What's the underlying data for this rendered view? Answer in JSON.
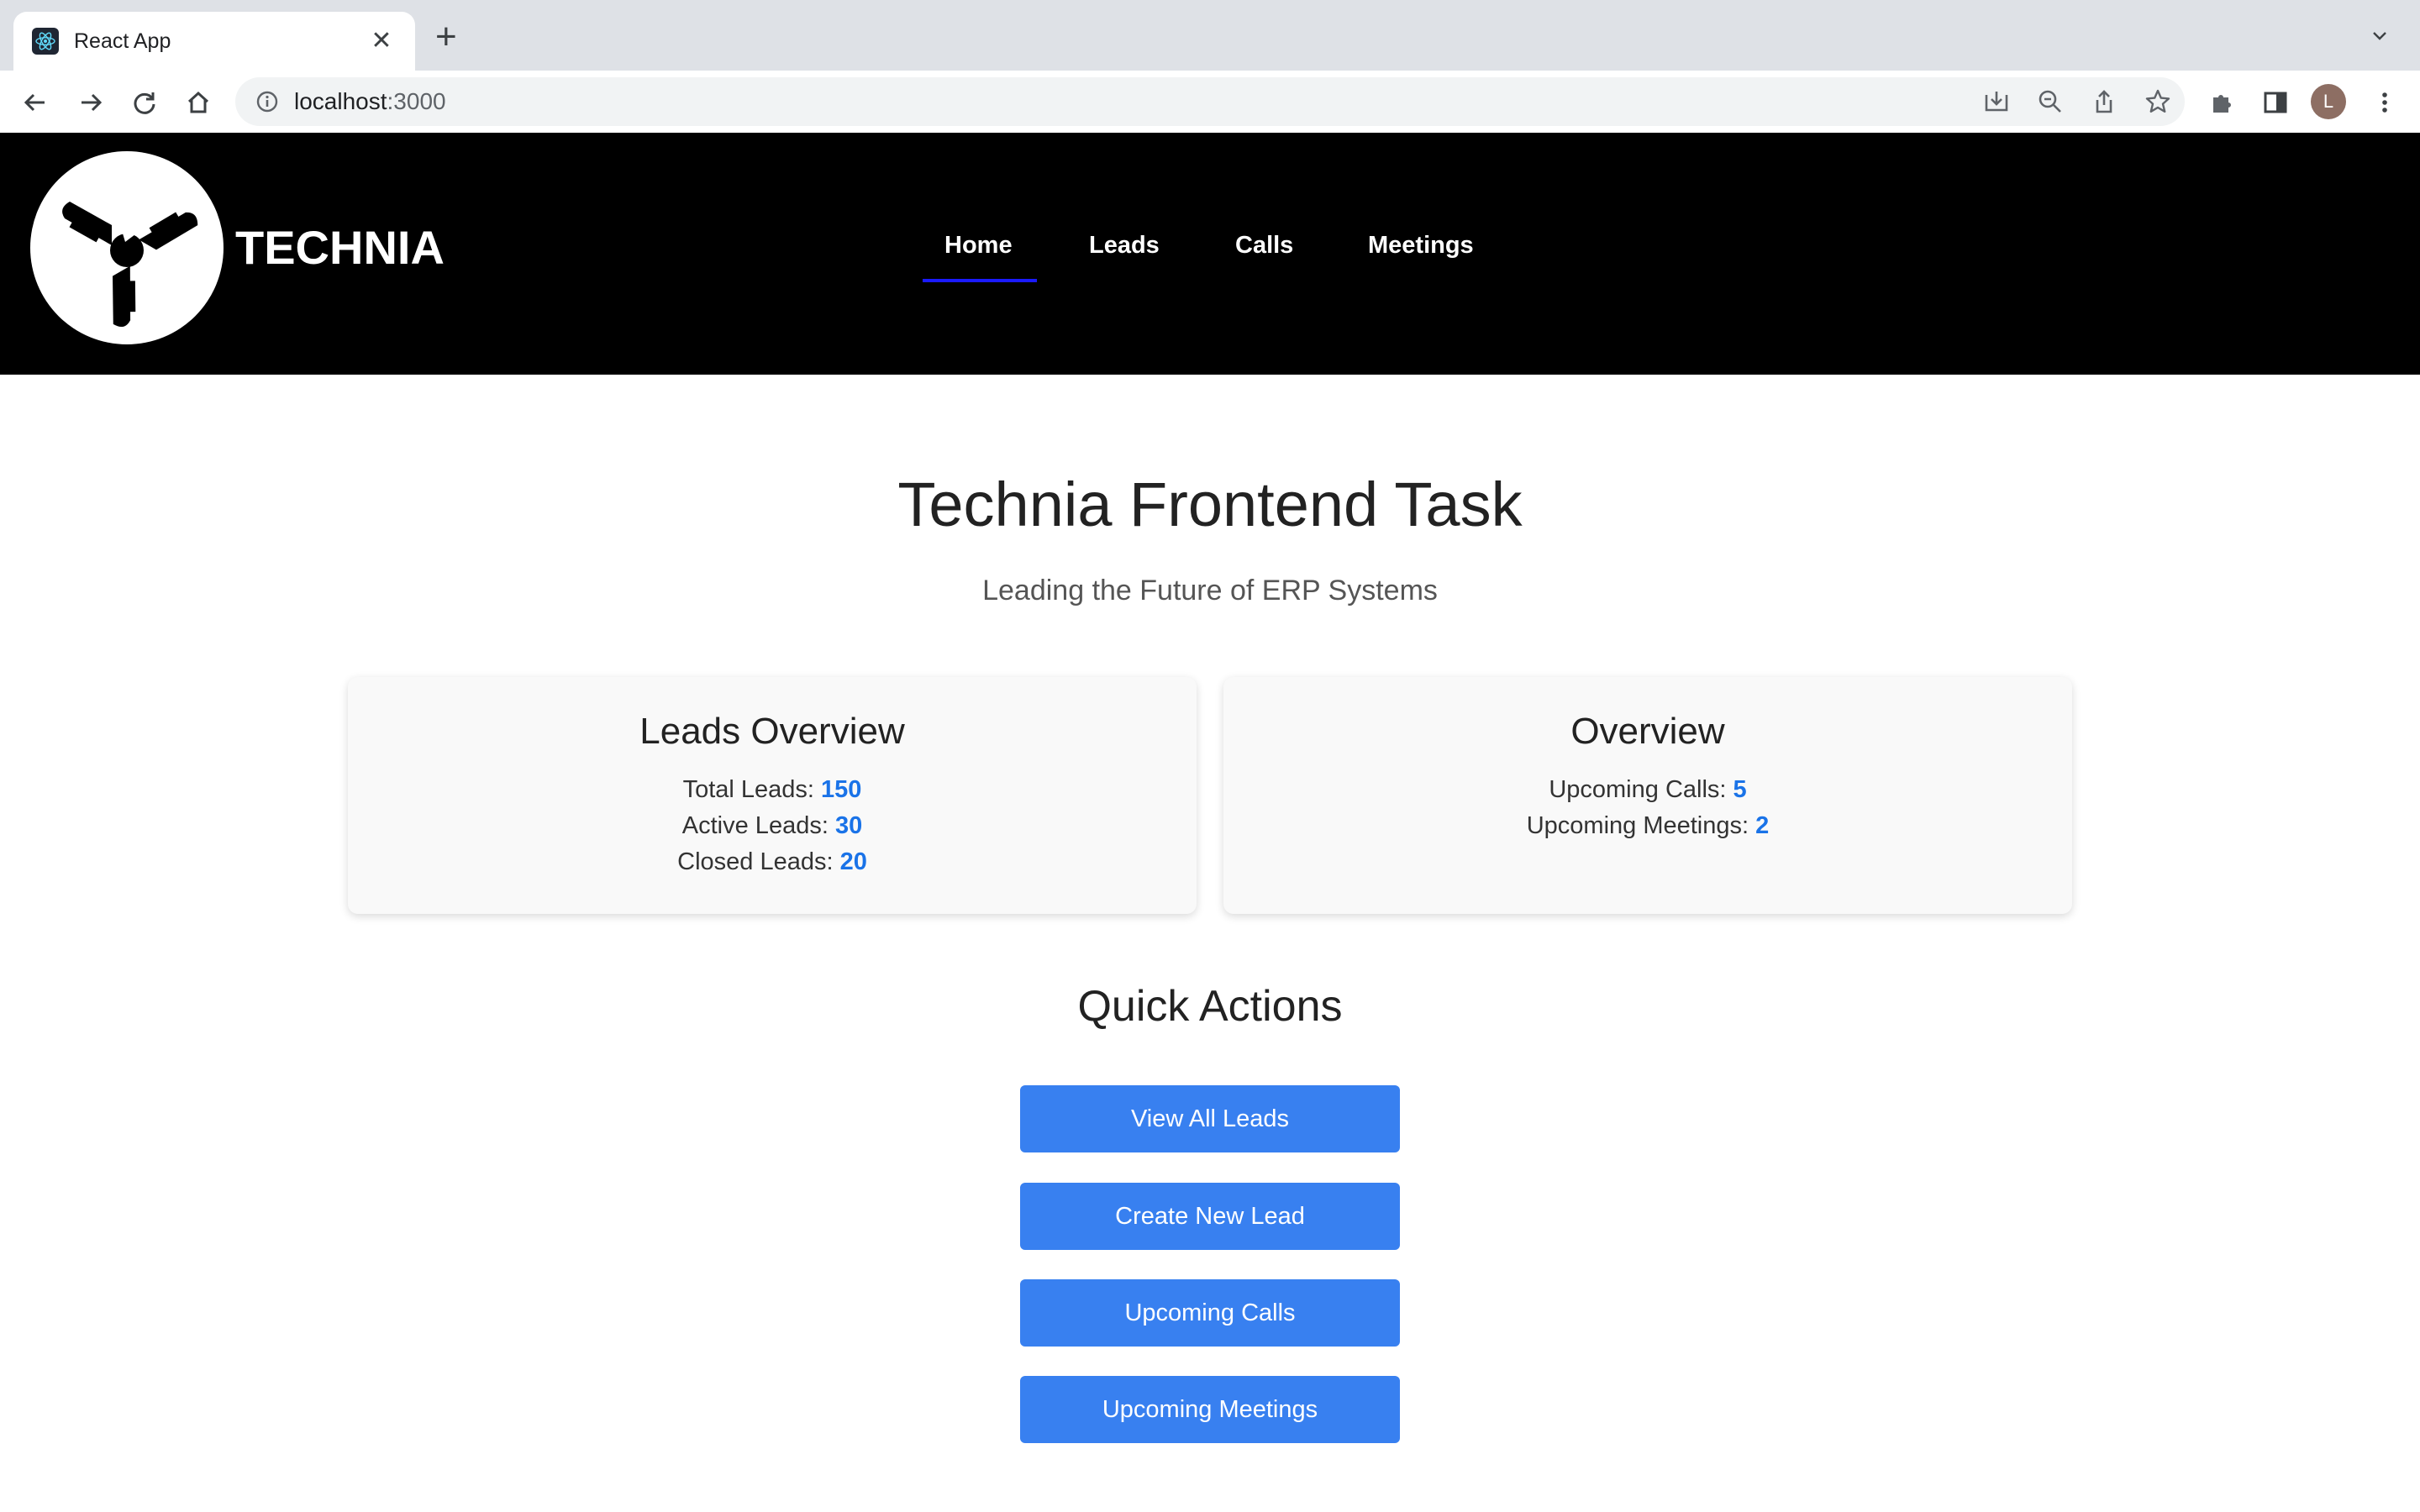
{
  "browser": {
    "tab_title": "React App",
    "url_host": "localhost",
    "url_port": ":3000",
    "avatar_letter": "L"
  },
  "navbar": {
    "brand": "TECHNIA",
    "items": [
      {
        "label": "Home",
        "active": true
      },
      {
        "label": "Leads",
        "active": false
      },
      {
        "label": "Calls",
        "active": false
      },
      {
        "label": "Meetings",
        "active": false
      }
    ]
  },
  "hero": {
    "title": "Technia Frontend Task",
    "subtitle": "Leading the Future of ERP Systems"
  },
  "leads_card": {
    "title": "Leads Overview",
    "total_label": "Total Leads: ",
    "total_value": "150",
    "active_label": "Active Leads: ",
    "active_value": "30",
    "closed_label": "Closed Leads: ",
    "closed_value": "20"
  },
  "overview_card": {
    "title": "Overview",
    "calls_label": "Upcoming Calls: ",
    "calls_value": "5",
    "meetings_label": "Upcoming Meetings: ",
    "meetings_value": "2"
  },
  "quick_actions": {
    "title": "Quick Actions",
    "buttons": [
      "View All Leads",
      "Create New Lead",
      "Upcoming Calls",
      "Upcoming Meetings"
    ]
  },
  "colors": {
    "accent_button": "#3880f0",
    "stat_number": "#1a73e8",
    "nav_active_underline": "#1a1aff",
    "navbar_bg": "#000000"
  }
}
